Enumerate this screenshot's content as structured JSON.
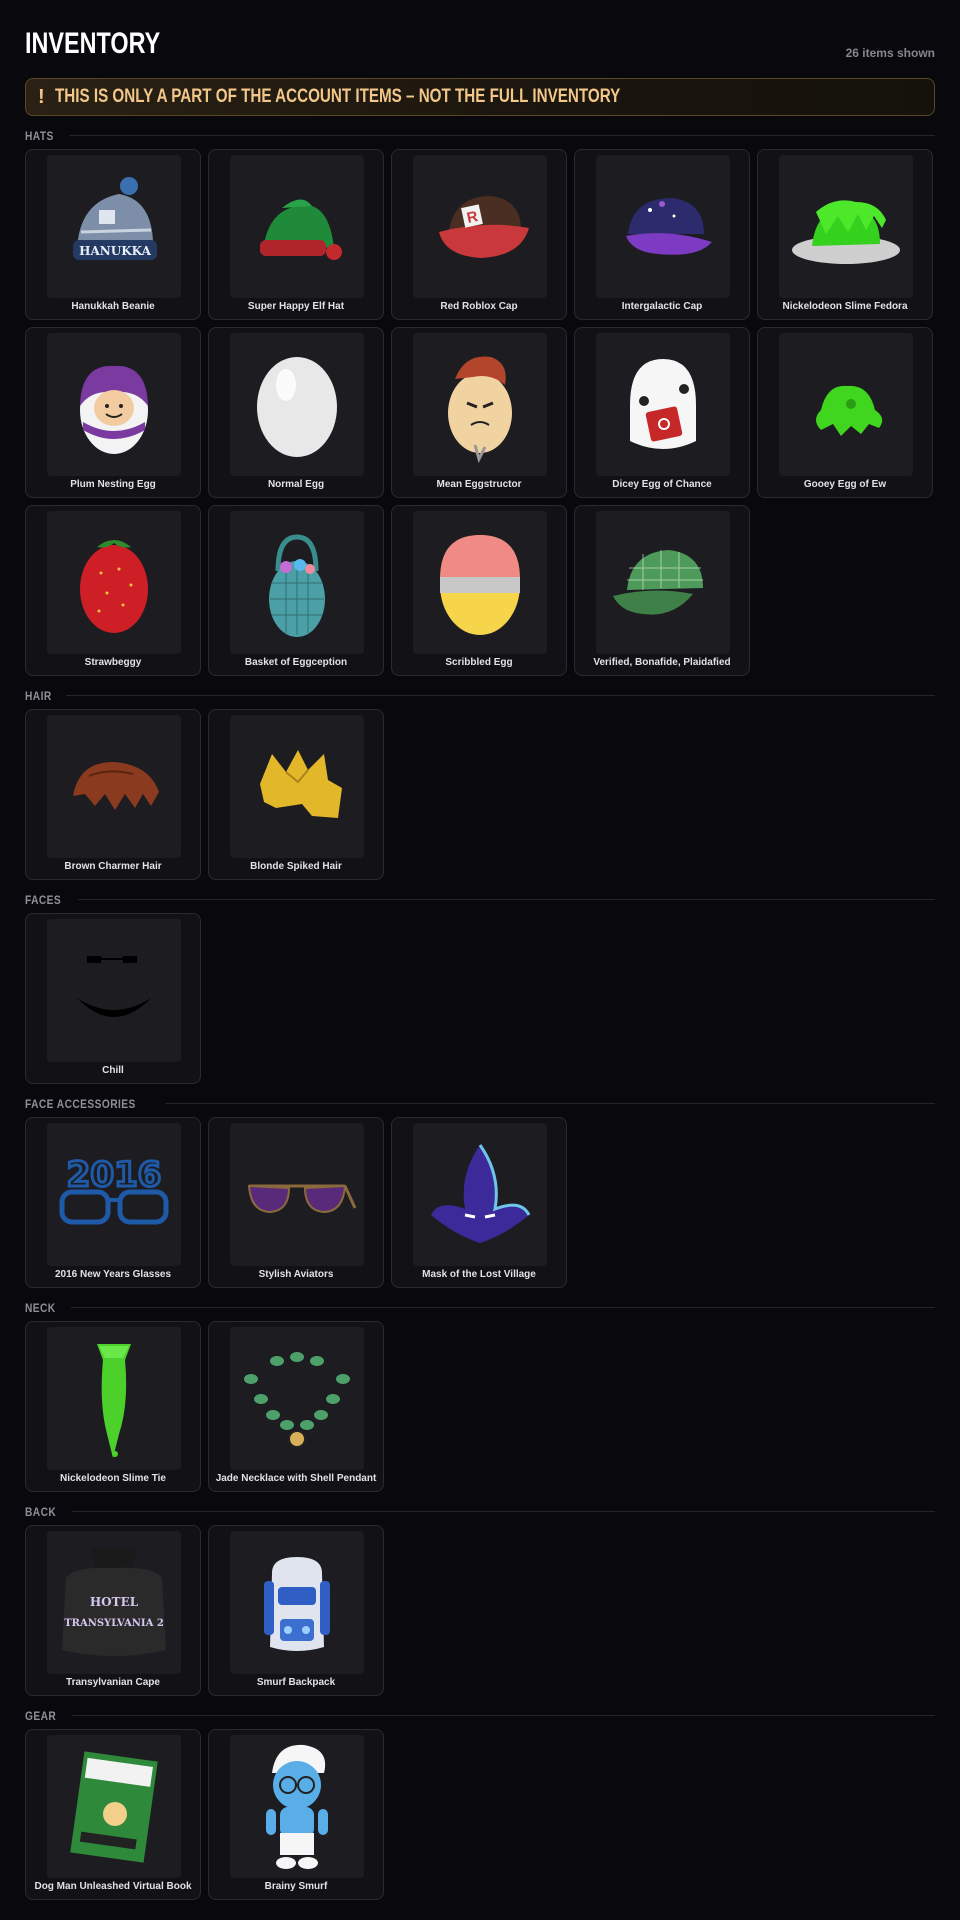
{
  "header": {
    "title": "INVENTORY",
    "count": "26 items shown"
  },
  "notice": {
    "icon": "!",
    "text": "THIS IS ONLY A PART OF THE ACCOUNT ITEMS – NOT THE FULL INVENTORY"
  },
  "sections": [
    {
      "title": "HATS",
      "items": [
        {
          "name": "Hanukkah Beanie",
          "icon": "beanie-icon"
        },
        {
          "name": "Super Happy Elf Hat",
          "icon": "elf-hat-icon"
        },
        {
          "name": "Red Roblox Cap",
          "icon": "red-cap-icon"
        },
        {
          "name": "Intergalactic Cap",
          "icon": "galaxy-cap-icon"
        },
        {
          "name": "Nickelodeon Slime Fedora",
          "icon": "slime-fedora-icon"
        },
        {
          "name": "Plum Nesting Egg",
          "icon": "plum-egg-icon"
        },
        {
          "name": "Normal Egg",
          "icon": "normal-egg-icon"
        },
        {
          "name": "Mean Eggstructor",
          "icon": "mean-egg-icon"
        },
        {
          "name": "Dicey Egg of Chance",
          "icon": "dice-egg-icon"
        },
        {
          "name": "Gooey Egg of Ew",
          "icon": "gooey-egg-icon"
        },
        {
          "name": "Strawbeggy",
          "icon": "strawberry-egg-icon"
        },
        {
          "name": "Basket of Eggception",
          "icon": "basket-egg-icon"
        },
        {
          "name": "Scribbled Egg",
          "icon": "scribbled-egg-icon"
        },
        {
          "name": "Verified, Bonafide, Plaidafied",
          "icon": "plaid-cap-icon"
        }
      ]
    },
    {
      "title": "HAIR",
      "items": [
        {
          "name": "Brown Charmer Hair",
          "icon": "brown-hair-icon"
        },
        {
          "name": "Blonde Spiked Hair",
          "icon": "blonde-hair-icon"
        }
      ]
    },
    {
      "title": "FACES",
      "items": [
        {
          "name": "Chill",
          "icon": "chill-face-icon"
        }
      ]
    },
    {
      "title": "FACE ACCESSORIES",
      "items": [
        {
          "name": "2016 New Years Glasses",
          "icon": "glasses-2016-icon"
        },
        {
          "name": "Stylish Aviators",
          "icon": "aviators-icon"
        },
        {
          "name": "Mask of the Lost Village",
          "icon": "leaf-mask-icon"
        }
      ]
    },
    {
      "title": "NECK",
      "items": [
        {
          "name": "Nickelodeon Slime Tie",
          "icon": "slime-tie-icon"
        },
        {
          "name": "Jade Necklace with Shell Pendant",
          "icon": "jade-necklace-icon"
        }
      ]
    },
    {
      "title": "BACK",
      "items": [
        {
          "name": "Transylvanian Cape",
          "icon": "cape-icon",
          "art_text": [
            "HOTEL",
            "TRANSYLVANIA 2"
          ]
        },
        {
          "name": "Smurf Backpack",
          "icon": "backpack-icon"
        }
      ]
    },
    {
      "title": "GEAR",
      "items": [
        {
          "name": "Dog Man Unleashed Virtual Book",
          "icon": "book-icon"
        },
        {
          "name": "Brainy Smurf",
          "icon": "smurf-icon"
        }
      ]
    }
  ]
}
